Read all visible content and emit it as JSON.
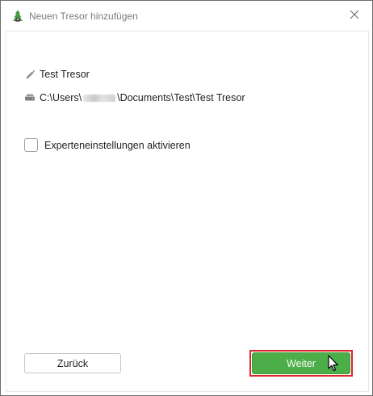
{
  "window": {
    "title": "Neuen Tresor hinzufügen",
    "app_icon": "cryptomator-vault-icon",
    "close_icon": "close-icon"
  },
  "vault": {
    "name": "Test Tresor",
    "name_icon": "pencil-icon",
    "path_prefix": "C:\\Users\\",
    "path_suffix": "\\Documents\\Test\\Test Tresor",
    "path_icon": "drive-icon"
  },
  "options": {
    "expert_settings_label": "Experteneinstellungen aktivieren",
    "expert_settings_checked": false
  },
  "buttons": {
    "back_label": "Zurück",
    "next_label": "Weiter"
  },
  "colors": {
    "primary": "#4cae48",
    "highlight": "#d8262b",
    "title_text": "#7a7a7a"
  }
}
